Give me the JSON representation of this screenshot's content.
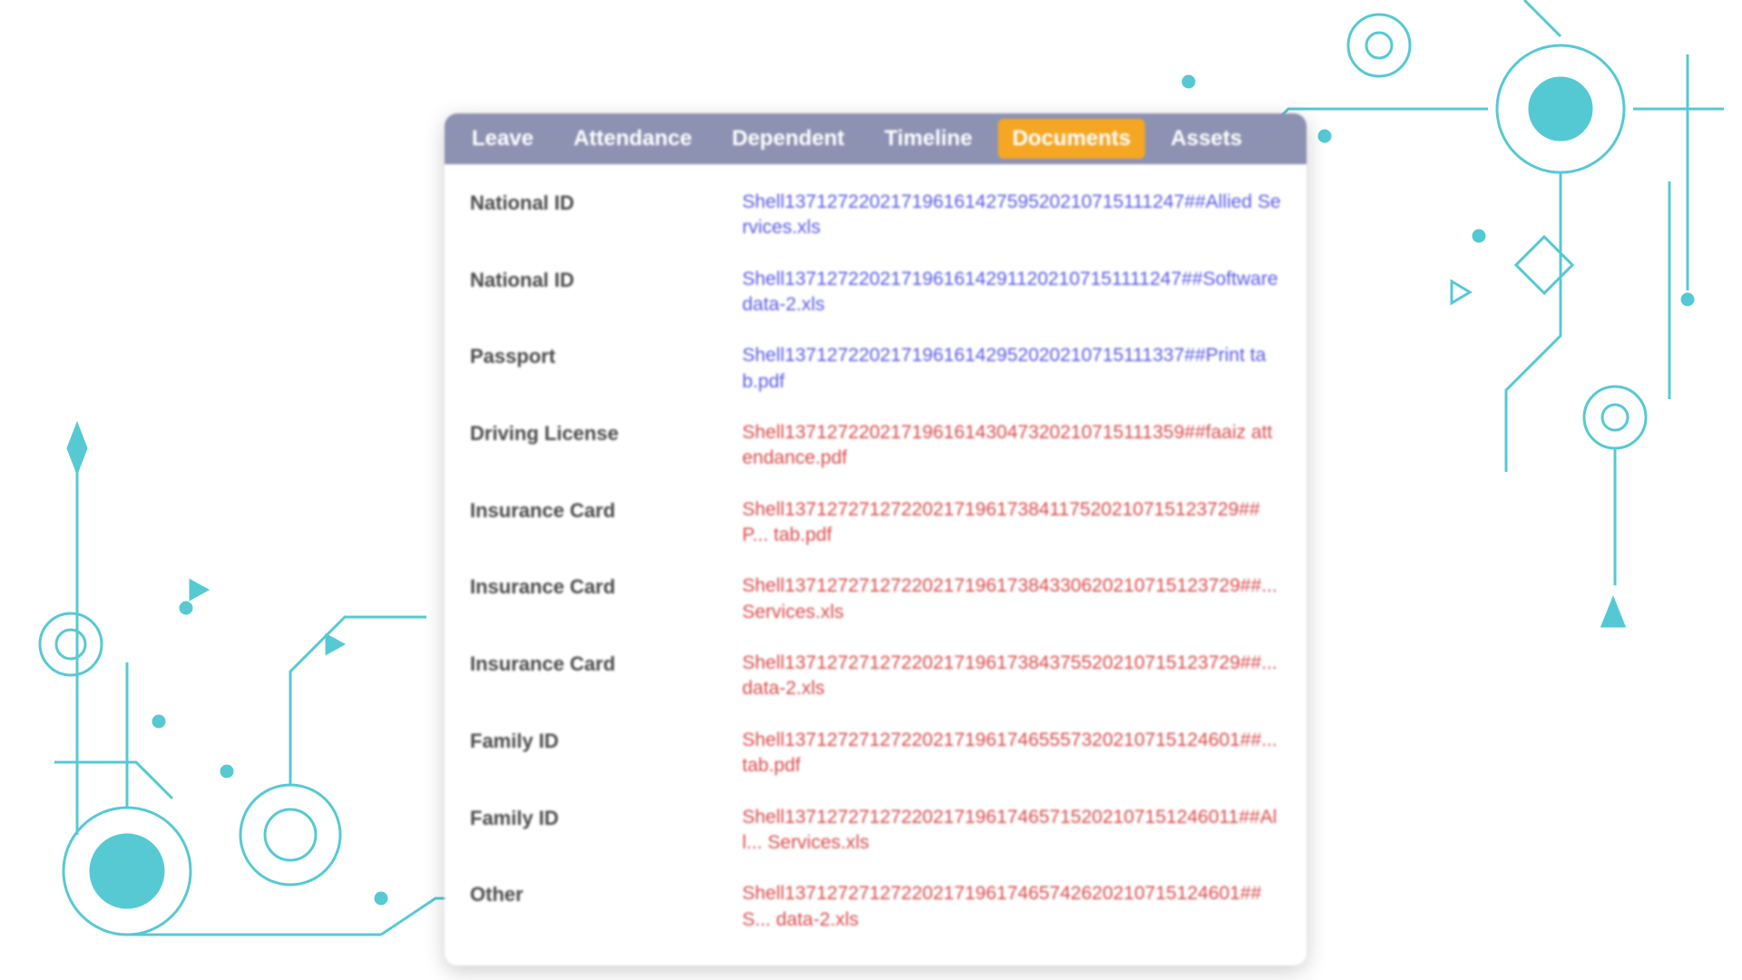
{
  "tabs": [
    {
      "label": "Leave",
      "active": false
    },
    {
      "label": "Attendance",
      "active": false
    },
    {
      "label": "Dependent",
      "active": false
    },
    {
      "label": "Timeline",
      "active": false
    },
    {
      "label": "Documents",
      "active": true
    },
    {
      "label": "Assets",
      "active": false
    }
  ],
  "documents": [
    {
      "type": "National ID",
      "file": "Shell13712722021719616142759520210715111247##Allied Services.xls",
      "theme": "blue"
    },
    {
      "type": "National ID",
      "file": "Shell13712722021719616142911202107151111247##Software data-2.xls",
      "theme": "blue"
    },
    {
      "type": "Passport",
      "file": "Shell13712722021719616142952020210715111337##Print tab.pdf",
      "theme": "blue"
    },
    {
      "type": "Driving License",
      "file": "Shell13712722021719616143047320210715111359##faaiz attendance.pdf",
      "theme": "red"
    },
    {
      "type": "Insurance Card",
      "file": "Shell1371272712722021719617384117520210715123729##P... tab.pdf",
      "theme": "red"
    },
    {
      "type": "Insurance Card",
      "file": "Shell1371272712722021719617384330620210715123729##... Services.xls",
      "theme": "red"
    },
    {
      "type": "Insurance Card",
      "file": "Shell1371272712722021719617384375520210715123729##... data-2.xls",
      "theme": "red"
    },
    {
      "type": "Family ID",
      "file": "Shell1371272712722021719617465557320210715124601##... tab.pdf",
      "theme": "red"
    },
    {
      "type": "Family ID",
      "file": "Shell1371272712722021719617465715202107151246011##All... Services.xls",
      "theme": "red"
    },
    {
      "type": "Other",
      "file": "Shell1371272712722021719617465742620210715124601##S... data-2.xls",
      "theme": "red"
    }
  ],
  "colors": {
    "tabbar_bg": "#8d92b3",
    "active_tab": "#f5a623",
    "link_blue": "#5a5ae6",
    "link_red": "#d94a4a",
    "decor": "#38c0cc"
  }
}
